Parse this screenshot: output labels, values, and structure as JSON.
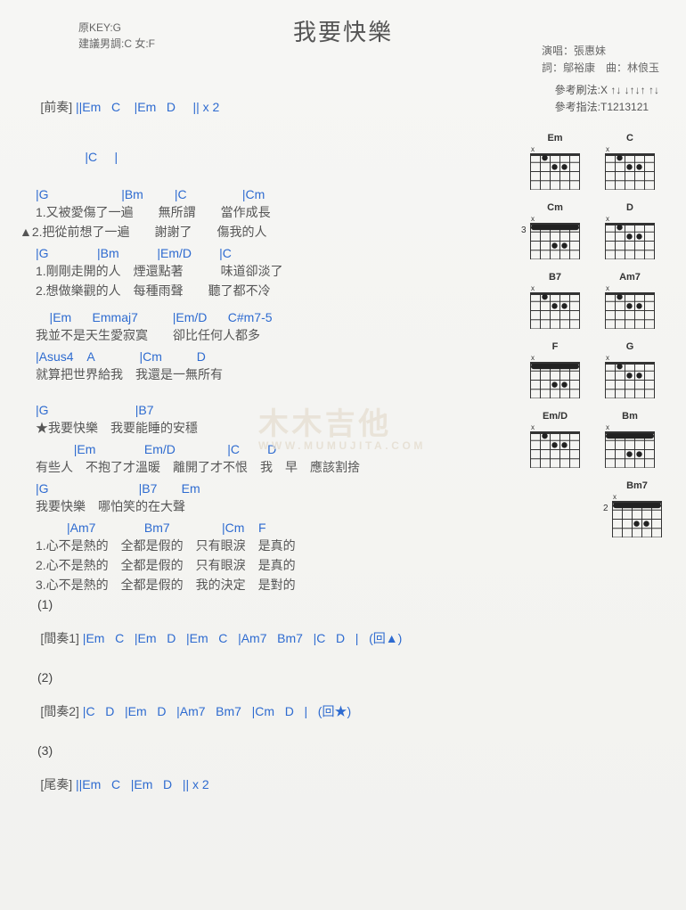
{
  "meta": {
    "originalKeyLabel": "原KEY:G",
    "suggestKeyLabel": "建議男調:C 女:F",
    "title": "我要快樂",
    "singerLabel": "演唱：張惠妹",
    "creditsLabel": "詞：鄔裕康　曲：林俍玉",
    "strumLabel": "參考刷法:X ↑↓ ↓↑↓↑ ↑↓",
    "fingerLabel": "參考指法:T1213121"
  },
  "watermark": {
    "top": "木木吉他",
    "sub": "WWW.MUMUJITA.COM"
  },
  "intro": {
    "label": "[前奏]",
    "bars1": "||Em   C    |Em   D     || x 2",
    "bars2": "|C     |"
  },
  "verse1": {
    "chords": "|G                     |Bm         |C                |Cm",
    "l1": "1.又被愛傷了一遍　　無所謂　　當作成長",
    "l2": "▲2.把從前想了一遍　　謝謝了　　傷我的人",
    "chords2": "|G              |Bm           |Em/D        |C",
    "l3": "1.剛剛走開的人　煙還點著　　　味道卻淡了",
    "l4": "2.想做樂觀的人　每種雨聲　　聽了都不冷"
  },
  "pre": {
    "chords": "    |Em      Emmaj7          |Em/D      C#m7-5",
    "l1": "我並不是天生愛寂寞　　卻比任何人都多",
    "chords2": "|Asus4    A             |Cm          D",
    "l2": "就算把世界給我　我還是一無所有"
  },
  "chorus": {
    "chords": "|G                         |B7",
    "l1": "★我要快樂　我要能睡的安穩",
    "chords2": "           |Em              Em/D               |C        D",
    "l2": "有些人　不抱了才溫暖　離開了才不恨　我　早　應該割捨",
    "chords3": "|G                          |B7       Em",
    "l3": "我要快樂　哪怕笑的在大聲",
    "chords4": "         |Am7              Bm7               |Cm    F",
    "l4a": "1.心不是熱的　全都是假的　只有眼淚　是真的",
    "l4b": "2.心不是熱的　全都是假的　只有眼淚　是真的",
    "l4c": "3.心不是熱的　全都是假的　我的決定　是對的"
  },
  "tags": {
    "t1": "(1)",
    "inter1Label": "[間奏1]",
    "inter1": " |Em   C   |Em   D   |Em   C   |Am7   Bm7   |C   D   |   (回▲)",
    "t2": "(2)",
    "inter2Label": "[間奏2]",
    "inter2": " |C   D   |Em   D   |Am7   Bm7   |Cm   D   |   (回★)",
    "t3": "(3)",
    "outroLabel": "[尾奏]",
    "outro": " ||Em   C   |Em   D   || x 2"
  },
  "diagrams": [
    [
      {
        "name": "Em"
      },
      {
        "name": "C"
      }
    ],
    [
      {
        "name": "Cm",
        "barre": true,
        "fret": "3"
      },
      {
        "name": "D"
      }
    ],
    [
      {
        "name": "B7"
      },
      {
        "name": "Am7"
      }
    ],
    [
      {
        "name": "F",
        "barre": true
      },
      {
        "name": "G"
      }
    ],
    [
      {
        "name": "Em/D"
      },
      {
        "name": "Bm",
        "barre": true
      }
    ],
    [
      {
        "name": "Bm7",
        "barre": true,
        "fret": "2",
        "single": true
      }
    ]
  ]
}
